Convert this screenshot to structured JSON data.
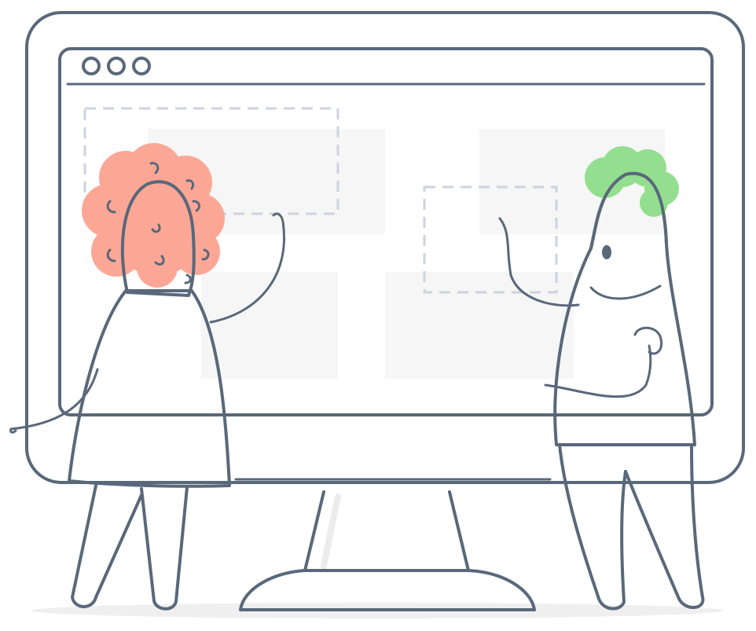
{
  "illustration": {
    "colors": {
      "outline": "#59687a",
      "monitor_bezel": "#f6f6f6",
      "screen": "#ffffff",
      "placeholder_block": "#f6f6f6",
      "selection_dashes": "#cfd2df",
      "hair_left_person": "#fca796",
      "hair_right_person": "#93df8f",
      "legs": "#e7e7e7",
      "shadow": "#ededed"
    },
    "window_controls": [
      "circle-icon",
      "circle-icon",
      "circle-icon"
    ],
    "people": [
      "person-with-coral-curly-hair",
      "person-with-green-hair"
    ]
  }
}
